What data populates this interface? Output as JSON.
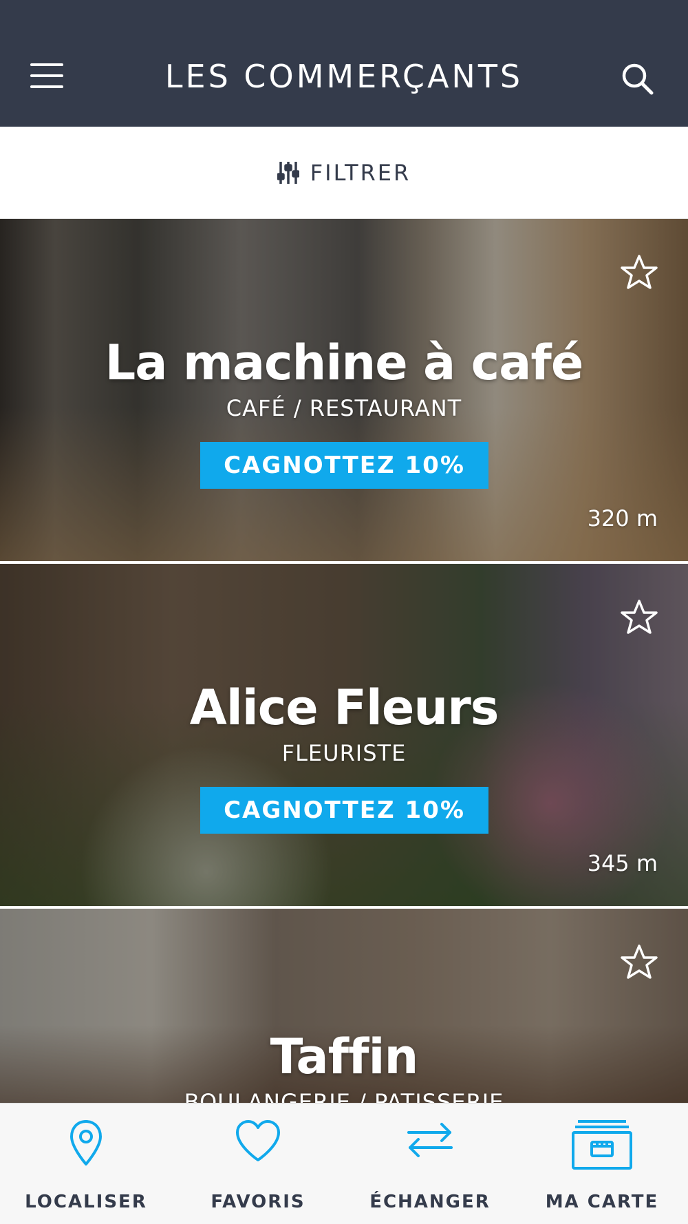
{
  "header": {
    "title": "LES COMMERÇANTS",
    "menu_icon": "hamburger-menu-icon",
    "search_icon": "search-icon"
  },
  "filter": {
    "label": "FILTRER",
    "icon": "sliders-icon"
  },
  "shops": [
    {
      "name": "La machine à café",
      "category": "CAFÉ / RESTAURANT",
      "cashback": "CAGNOTTEZ 10%",
      "distance": "320 m",
      "favorite_icon": "star-outline-icon"
    },
    {
      "name": "Alice Fleurs",
      "category": "FLEURISTE",
      "cashback": "CAGNOTTEZ 10%",
      "distance": "345 m",
      "favorite_icon": "star-outline-icon"
    },
    {
      "name": "Taffin",
      "category": "BOULANGERIE / PATISSERIE",
      "favorite_icon": "star-outline-icon"
    }
  ],
  "bottom_nav": [
    {
      "label": "LOCALISER",
      "icon": "map-pin-icon"
    },
    {
      "label": "FAVORIS",
      "icon": "heart-icon"
    },
    {
      "label": "ÉCHANGER",
      "icon": "exchange-arrows-icon"
    },
    {
      "label": "MA CARTE",
      "icon": "card-shop-icon"
    }
  ],
  "colors": {
    "header_bg": "#343b4b",
    "accent": "#10a9ec",
    "text_dark": "#343b4b"
  }
}
